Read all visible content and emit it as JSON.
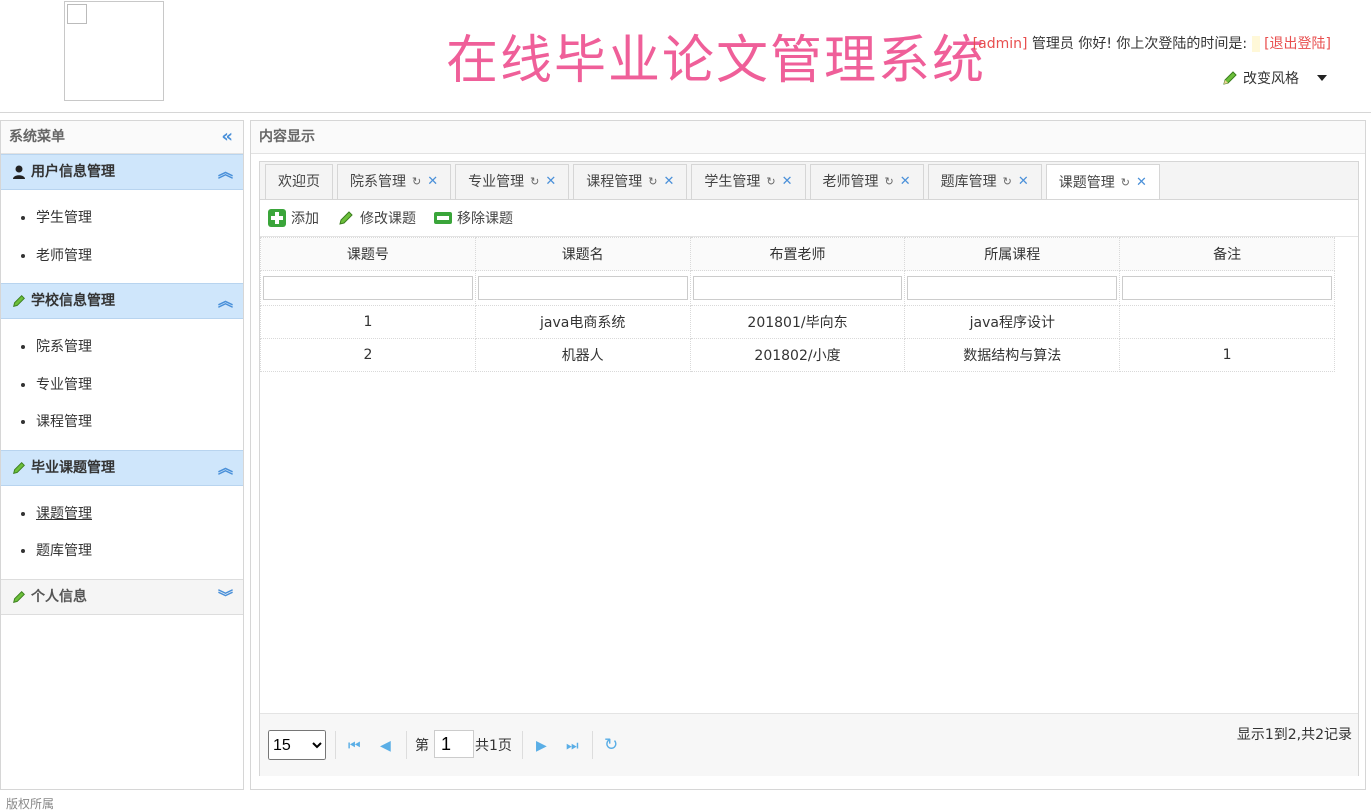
{
  "header": {
    "title": "在线毕业论文管理系统",
    "user": "[admin]",
    "greeting": "管理员 你好! 你上次登陆的时间是:",
    "logout": "[退出登陆]",
    "style_switch": "改变风格"
  },
  "sidebar": {
    "title": "系统菜单",
    "groups": [
      {
        "title": "用户信息管理",
        "items": [
          "学生管理",
          "老师管理"
        ]
      },
      {
        "title": "学校信息管理",
        "items": [
          "院系管理",
          "专业管理",
          "课程管理"
        ]
      },
      {
        "title": "毕业课题管理",
        "items": [
          "课题管理",
          "题库管理"
        ]
      },
      {
        "title": "个人信息",
        "items": []
      }
    ]
  },
  "content": {
    "title": "内容显示",
    "tabs": [
      "欢迎页",
      "院系管理",
      "专业管理",
      "课程管理",
      "学生管理",
      "老师管理",
      "题库管理",
      "课题管理"
    ],
    "toolbar": {
      "add": "添加",
      "edit": "修改课题",
      "remove": "移除课题"
    },
    "table": {
      "columns": [
        "课题号",
        "课题名",
        "布置老师",
        "所属课程",
        "备注"
      ],
      "rows": [
        [
          "1",
          "java电商系统",
          "201801/毕向东",
          "java程序设计",
          ""
        ],
        [
          "2",
          "机器人",
          "201802/小度",
          "数据结构与算法",
          "1"
        ]
      ]
    },
    "pager": {
      "page_size": "15",
      "page_prefix": "第",
      "page_value": "1",
      "total_pages": "共1页",
      "info": "显示1到2,共2记录"
    }
  },
  "footer": {
    "text": "版权所属"
  }
}
